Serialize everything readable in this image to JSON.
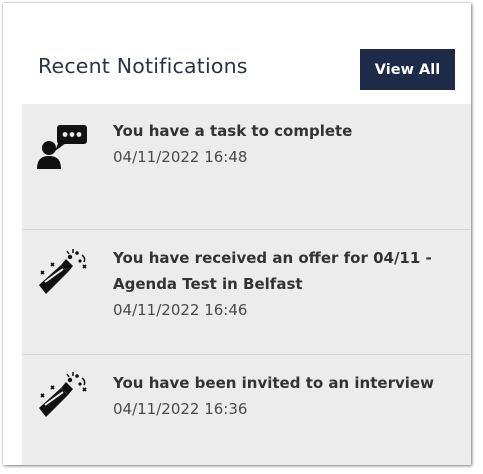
{
  "widget": {
    "title": "Recent Notifications",
    "view_all_label": "View All"
  },
  "notifications": [
    {
      "icon": "user-chat-icon",
      "message": "You have a task to complete",
      "timestamp": "04/11/2022 16:48"
    },
    {
      "icon": "champagne-icon",
      "message": "You have received an offer for 04/11 - Agenda Test in Belfast",
      "timestamp": "04/11/2022 16:46"
    },
    {
      "icon": "champagne-icon",
      "message": "You have been invited to an interview",
      "timestamp": "04/11/2022 16:36"
    }
  ],
  "colors": {
    "button_bg": "#1e2b48",
    "list_bg": "#ececec",
    "title_text": "#2a3442"
  }
}
